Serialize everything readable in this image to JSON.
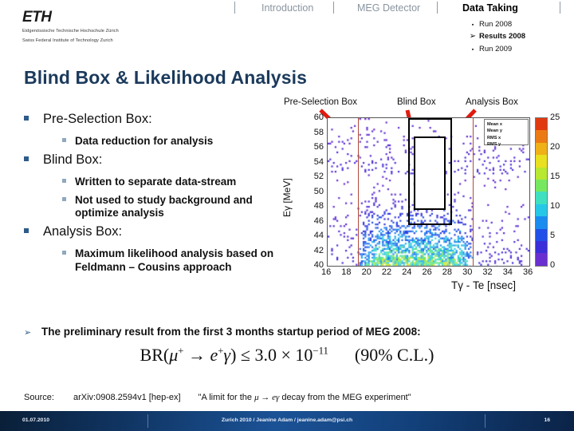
{
  "logo": {
    "mark": "ETH",
    "line1": "Eidgenössische Technische Hochschule Zürich",
    "line2": "Swiss Federal Institute of Technology Zurich"
  },
  "topnav": {
    "items": [
      {
        "label": "Introduction",
        "active": false
      },
      {
        "label": "MEG Detector",
        "active": false
      },
      {
        "label": "Data Taking",
        "active": true
      }
    ],
    "subitems": [
      {
        "label": "Run 2008",
        "current": false,
        "bullet": "▪"
      },
      {
        "label": "Results 2008",
        "current": true,
        "bullet": "➢"
      },
      {
        "label": "Run 2009",
        "current": false,
        "bullet": "▪"
      }
    ]
  },
  "title": "Blind Box & Likelihood Analysis",
  "bullets": [
    {
      "level": 1,
      "text": "Pre-Selection Box:"
    },
    {
      "level": 2,
      "text": "Data reduction for analysis"
    },
    {
      "level": 1,
      "text": "Blind Box:"
    },
    {
      "level": 2,
      "text": "Written to separate data-stream"
    },
    {
      "level": 2,
      "text": "Not used to study background and optimize analysis"
    },
    {
      "level": 1,
      "text": "Analysis Box:"
    },
    {
      "level": 2,
      "text": "Maximum likelihood analysis based on Feldmann – Cousins approach"
    }
  ],
  "annotations": {
    "preselection": "Pre-Selection Box",
    "blind": "Blind Box",
    "analysis": "Analysis Box",
    "arrow_color": "#e01b10"
  },
  "stats_box": [
    "Mean x",
    "Mean y",
    "RMS x",
    "RMS y"
  ],
  "result": {
    "arrow": "➢",
    "text": "The preliminary result from the first 3 months startup period of MEG 2008:",
    "formula_parts": {
      "br": "BR",
      "open": "(",
      "mu": "μ",
      "mu_sup": "+",
      "arrow": "→",
      "e": "e",
      "e_sup": "+",
      "gamma": "γ",
      "close": ")",
      "le": "≤",
      "value": "3.0",
      "times": "×",
      "base": "10",
      "exp": "−11",
      "cl": "(90% C.L.)"
    }
  },
  "source": {
    "label": "Source:",
    "ref": "arXiv:0908.2594v1 [hep-ex]",
    "quote_open": "\"A limit for the ",
    "quote_math": "μ → eγ",
    "quote_close": " decay from the MEG experiment\""
  },
  "footer": {
    "date": "01.07.2010",
    "center": "Zurich 2010 / Jeanine Adam / jeanine.adam@psi.ch",
    "page": "16"
  },
  "chart_data": {
    "type": "heatmap",
    "title": "",
    "xlabel": "Tγ - Te [nsec]",
    "ylabel": "Eγ [MeV]",
    "xlim": [
      16,
      36
    ],
    "ylim": [
      40,
      60
    ],
    "xticks": [
      16,
      18,
      20,
      22,
      24,
      26,
      28,
      30,
      32,
      34,
      36
    ],
    "yticks": [
      40,
      42,
      44,
      46,
      48,
      50,
      52,
      54,
      56,
      58,
      60
    ],
    "colorbar": {
      "ticks": [
        0,
        5,
        10,
        15,
        20,
        25
      ],
      "min": 0,
      "max": 25,
      "colors": [
        "#6a2fd0",
        "#3a2fd8",
        "#2050e8",
        "#1a8cf0",
        "#26c8e8",
        "#3fe0c0",
        "#76e860",
        "#b8e830",
        "#e8e020",
        "#f0b018",
        "#ec7a14",
        "#e03a10"
      ]
    },
    "regions": [
      {
        "name": "pre-selection-box",
        "x0": 19.0,
        "x1": 30.4,
        "y0": 40,
        "y1": 60,
        "style": "vertical-red-lines"
      },
      {
        "name": "analysis-box",
        "x0": 24.0,
        "x1": 28.0,
        "y0": 46.0,
        "y1": 60.0,
        "style": "black-outline"
      },
      {
        "name": "blind-box",
        "x0": 24.5,
        "x1": 27.4,
        "y0": 48.0,
        "y1": 57.5,
        "style": "black-outline-blanked"
      }
    ],
    "grid": false,
    "legend_position": "top-right",
    "description": "2D density of photon energy vs gamma-positron timing difference; background populates low Eγ, blind box region is masked"
  }
}
